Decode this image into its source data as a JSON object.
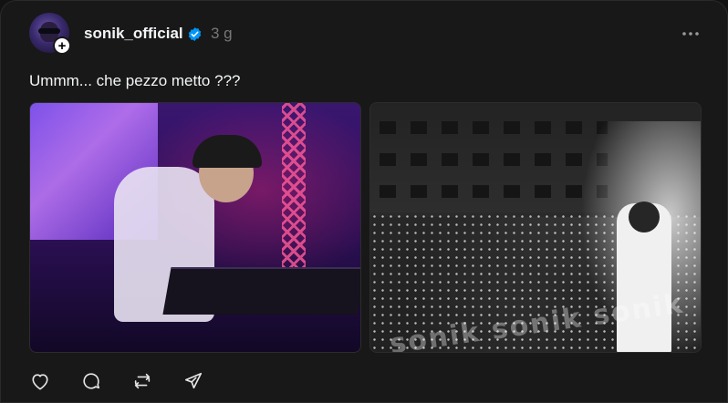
{
  "post": {
    "username": "sonik_official",
    "timestamp": "3 g",
    "text": "Ummm... che pezzo metto ???",
    "verified": true,
    "images": [
      {
        "icon": "photo-dj-at-decks"
      },
      {
        "icon": "photo-concert-crowd",
        "watermark": "sonik sonik sonik"
      }
    ]
  },
  "actions": [
    {
      "icon": "heart-icon"
    },
    {
      "icon": "comment-icon"
    },
    {
      "icon": "repost-icon"
    },
    {
      "icon": "share-icon"
    }
  ],
  "colors": {
    "background": "#181818",
    "text": "#f3f5f7",
    "muted": "#777777",
    "verified": "#0095f6"
  }
}
